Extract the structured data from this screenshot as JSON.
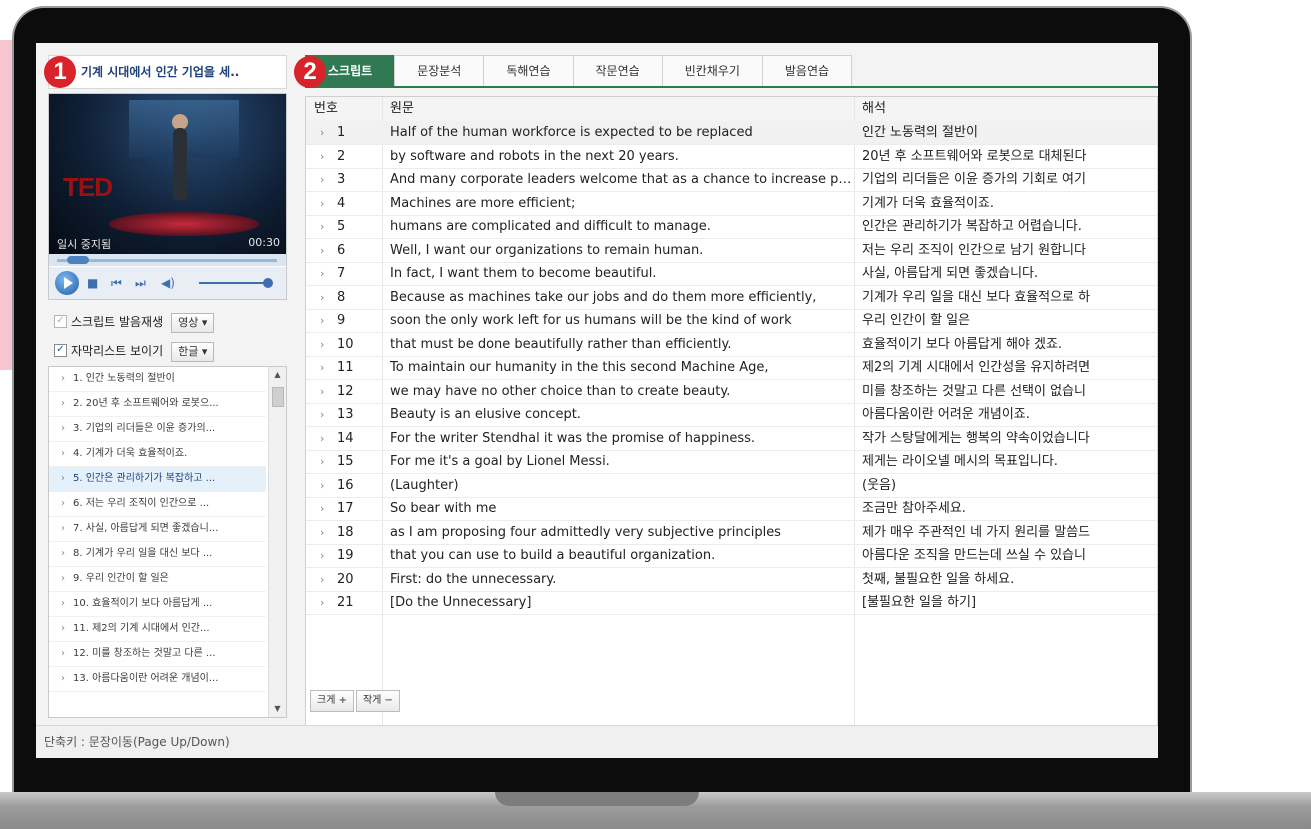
{
  "left": {
    "lesson_title": "기계 시대에서 인간 기업을 세..",
    "badge1": "1",
    "video": {
      "logo": "TED",
      "status": "일시 중지됨",
      "time": "00:30"
    },
    "option1": {
      "label": "스크립트 발음재생",
      "checked": "✓",
      "dropdown": "영상 ▾"
    },
    "option2": {
      "label": "자막리스트 보이기",
      "checked": "✓",
      "dropdown": "한글 ▾"
    },
    "sentence_list": [
      "1. 인간 노동력의 절반이",
      "2. 20년 후 소프트웨어와 로봇으...",
      "3. 기업의 리더들은 이윤 증가의...",
      "4. 기계가 더욱 효율적이죠.",
      "5. 인간은 관리하기가 복잡하고 ...",
      "6. 저는 우리 조직이  인간으로 ...",
      "7. 사실, 아름답게 되면 좋겠습니...",
      "8. 기계가 우리 일을 대신  보다 ...",
      "9. 우리 인간이 할 일은",
      "10. 효율적이기 보다 아름답게 ...",
      "11. 제2의 기계 시대에서  인간...",
      "12. 미를 창조하는 것말고  다른 ...",
      "13. 아름다움이란 어려운 개념이..."
    ],
    "selected_index": 4
  },
  "status_bar": "단축키 : 문장이동(Page Up/Down)",
  "right": {
    "badge2": "2",
    "tabs": [
      "스크립트",
      "문장분석",
      "독해연습",
      "작문연습",
      "빈칸채우기",
      "발음연습"
    ],
    "active_tab": 0,
    "headers": {
      "num": "번호",
      "original": "원문",
      "translation": "해석"
    },
    "rows": [
      {
        "num": "1",
        "en": "Half of the human workforce is expected to be replaced",
        "ko": "인간 노동력의 절반이"
      },
      {
        "num": "2",
        "en": "by software and robots in the next 20 years.",
        "ko": "20년 후 소프트웨어와 로봇으로  대체된다"
      },
      {
        "num": "3",
        "en": "And many corporate leaders welcome that as a chance to increase profits.",
        "ko": "기업의 리더들은 이윤 증가의  기회로 여기"
      },
      {
        "num": "4",
        "en": "Machines are more efficient;",
        "ko": "기계가 더욱 효율적이죠."
      },
      {
        "num": "5",
        "en": "humans are complicated and difficult to manage.",
        "ko": "인간은 관리하기가 복잡하고 어렵습니다."
      },
      {
        "num": "6",
        "en": "Well, I want our organizations to remain human.",
        "ko": "저는 우리 조직이  인간으로 남기 원합니다"
      },
      {
        "num": "7",
        "en": "In fact, I want them to become beautiful.",
        "ko": "사실, 아름답게 되면 좋겠습니다."
      },
      {
        "num": "8",
        "en": "Because as machines take our jobs and do them more efficiently,",
        "ko": "기계가 우리 일을 대신  보다 효율적으로 하"
      },
      {
        "num": "9",
        "en": "soon the only work left for us humans will be the kind of work",
        "ko": "우리 인간이 할 일은"
      },
      {
        "num": "10",
        "en": "that must be done beautifully rather than efficiently.",
        "ko": "효율적이기 보다 아름답게 해야 겠죠."
      },
      {
        "num": "11",
        "en": "To maintain our humanity in the this second Machine Age,",
        "ko": "제2의 기계 시대에서  인간성을 유지하려면"
      },
      {
        "num": "12",
        "en": "we may have no other choice than to create beauty.",
        "ko": "미를 창조하는 것말고  다른 선택이 없습니"
      },
      {
        "num": "13",
        "en": "Beauty is an elusive concept.",
        "ko": "아름다움이란 어려운 개념이죠."
      },
      {
        "num": "14",
        "en": "For the writer Stendhal it was the promise of happiness.",
        "ko": "작가 스탕달에게는  행복의 약속이었습니다"
      },
      {
        "num": "15",
        "en": "For me it's a goal by Lionel Messi.",
        "ko": "제게는 라이오넬 메시의 목표입니다."
      },
      {
        "num": "16",
        "en": "(Laughter)",
        "ko": "(웃음)"
      },
      {
        "num": "17",
        "en": "So bear with me",
        "ko": "조금만 참아주세요."
      },
      {
        "num": "18",
        "en": "as I am proposing four admittedly very subjective principles",
        "ko": "제가 매우 주관적인  네 가지 원리를 말씀드"
      },
      {
        "num": "19",
        "en": "that you can use to build a beautiful organization.",
        "ko": "아름다운 조직을 만드는데  쓰실 수 있습니"
      },
      {
        "num": "20",
        "en": "First: do the unnecessary.",
        "ko": "첫째, 불필요한 일을 하세요."
      },
      {
        "num": "21",
        "en": "[Do the Unnecessary]",
        "ko": "[불필요한 일을 하기]"
      }
    ],
    "highlight_row": 0,
    "size_buttons": {
      "bigger": "크게 +",
      "smaller": "작게 −"
    }
  },
  "colors": {
    "accent": "#2f7a52",
    "badge": "#d8232a",
    "title": "#1d3f7a"
  }
}
